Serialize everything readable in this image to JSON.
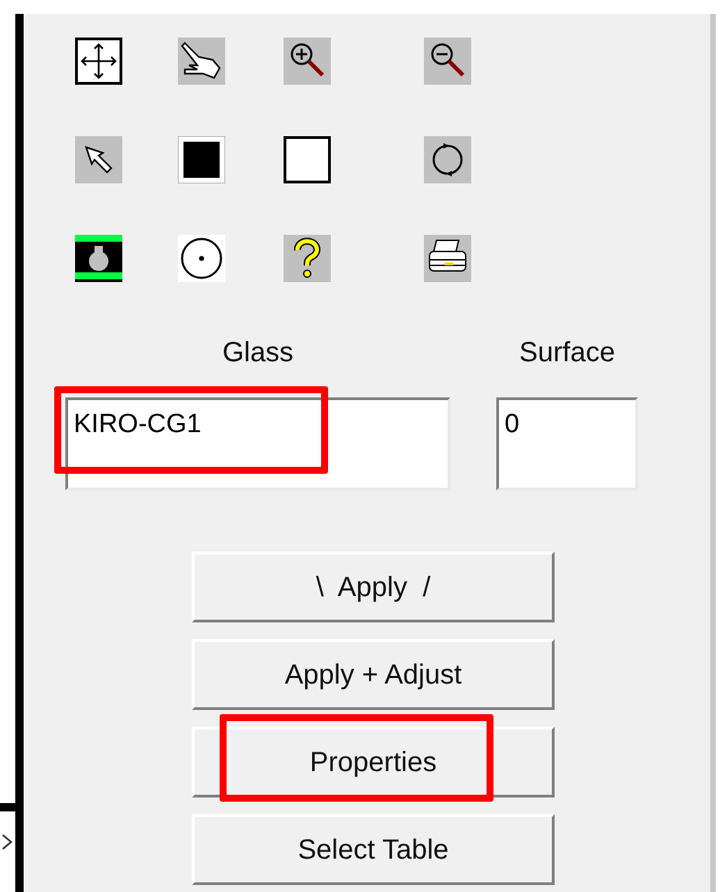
{
  "toolbar": [
    {
      "kind": "fit"
    },
    {
      "kind": "hand"
    },
    {
      "kind": "zoom-in"
    },
    {
      "kind": "zoom-out"
    },
    {
      "kind": "pointer"
    },
    {
      "kind": "black-square"
    },
    {
      "kind": "white-square"
    },
    {
      "kind": "rotate"
    },
    {
      "kind": "camera"
    },
    {
      "kind": "target"
    },
    {
      "kind": "help"
    },
    {
      "kind": "printer"
    }
  ],
  "fields": [
    {
      "label": "Glass",
      "value": "KIRO-CG1",
      "highlighted": true
    },
    {
      "label": "Surface",
      "value": "0",
      "highlighted": false
    }
  ],
  "buttons": [
    {
      "label": "\\  Apply  /",
      "highlighted": false
    },
    {
      "label": "Apply + Adjust",
      "highlighted": false
    },
    {
      "label": "Properties",
      "highlighted": true
    },
    {
      "label": "Select Table",
      "highlighted": false
    }
  ]
}
